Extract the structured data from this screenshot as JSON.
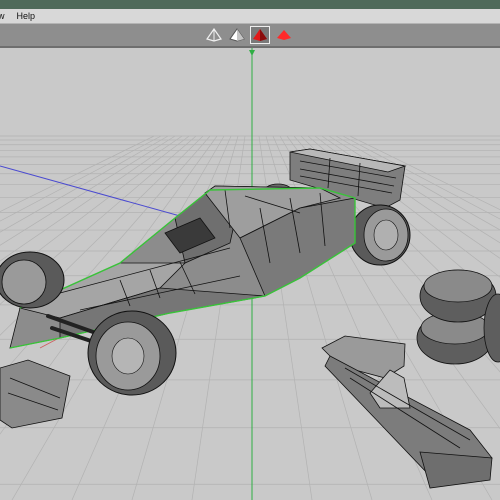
{
  "window": {
    "menu": [
      {
        "label": "w",
        "partial": true
      },
      {
        "label": "Help",
        "partial": false
      }
    ]
  },
  "toolbar": {
    "shading_modes": [
      {
        "icon": "wireframe-cone-icon",
        "active": false
      },
      {
        "icon": "hidden-line-cone-icon",
        "active": false
      },
      {
        "icon": "flat-shaded-cone-icon",
        "active": true
      },
      {
        "icon": "smooth-shaded-cone-icon",
        "active": false
      }
    ]
  },
  "viewport": {
    "background": "#c9c9c9",
    "grid_color": "#b0b0b0",
    "axis_colors": {
      "y": "#2fae44",
      "x": "#4a4ad0",
      "z": "#d03030"
    },
    "model_fill": "#8a8a8a",
    "wire_color": "#111111",
    "selection_color": "#39c439"
  }
}
